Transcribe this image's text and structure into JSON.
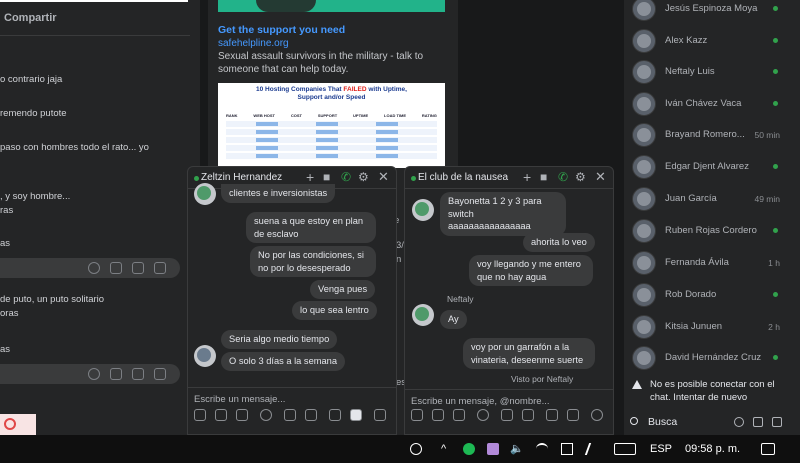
{
  "left_feed": {
    "share_label": "Compartir",
    "comments": [
      "o contrario jaja",
      "remendo putote",
      "paso con hombres todo el rato... yo",
      ", y soy hombre...",
      "ras",
      "as",
      " de puto, un puto solitario",
      "oras",
      "as"
    ]
  },
  "post": {
    "title": "Get the support you need",
    "url": "safehelpline.org",
    "description": "Sexual assault survivors in the military - talk to someone that can help today.",
    "image": {
      "title_prefix": "10 Hosting Companies That ",
      "title_highlight": "FAILED",
      "title_suffix": " with Uptime,",
      "title_line2": "Support and/or Speed",
      "columns": [
        "RANK",
        "WEB HOST",
        "COST",
        "SUPPORT",
        "UPTIME",
        "LOAD TIME",
        "RATING"
      ],
      "ranks": [
        "#1",
        "#2",
        "#3",
        "#4",
        "#5"
      ]
    },
    "fragments": [
      "e",
      "3/",
      "n",
      "es"
    ]
  },
  "contacts": [
    {
      "name": "Jesús Espinoza Moya",
      "online": true,
      "time": ""
    },
    {
      "name": "Alex Kazz",
      "online": true,
      "time": ""
    },
    {
      "name": "Neftaly Luis",
      "online": true,
      "time": ""
    },
    {
      "name": "Iván Chávez Vaca",
      "online": true,
      "time": ""
    },
    {
      "name": "Brayand Romero...",
      "online": false,
      "time": "50 min"
    },
    {
      "name": "Edgar Djent Alvarez",
      "online": true,
      "time": ""
    },
    {
      "name": "Juan García",
      "online": false,
      "time": "49 min"
    },
    {
      "name": "Ruben Rojas Cordero",
      "online": true,
      "time": ""
    },
    {
      "name": "Fernanda Ávila",
      "online": false,
      "time": "1 h"
    },
    {
      "name": "Rob Dorado",
      "online": true,
      "time": ""
    },
    {
      "name": "Kitsia Junuen",
      "online": false,
      "time": "2 h"
    },
    {
      "name": "David Hernández Cruz",
      "online": true,
      "time": ""
    }
  ],
  "connection_warning": "No es posible conectar con el chat. Intentar de nuevo",
  "search_label": "Busca",
  "chat1": {
    "title": "Zeltzin Hernandez",
    "messages": [
      "clientes e inversionistas",
      "suena a que estoy en plan de esclavo",
      "No por las condiciones, si no por lo desesperado",
      "Venga pues",
      "lo que sea lentro",
      "Seria algo medio tiempo",
      "O solo 3 días a la semana"
    ],
    "placeholder": "Escribe un mensaje..."
  },
  "chat2": {
    "title": "El club de la nausea",
    "messages": [
      "Bayonetta 1 2 y 3 para switch aaaaaaaaaaaaaaaa",
      "ahorita lo veo",
      "voy llegando y me entero que no hay agua",
      "Ay",
      "voy por un garrafón a la vinateria, deseenme suerte"
    ],
    "sender_label": "Neftaly",
    "seen_label": "Visto por Neftaly",
    "placeholder": "Escribe un mensaje, @nombre..."
  },
  "taskbar": {
    "language": "ESP",
    "time": "09:58 p. m."
  },
  "colors": {
    "accent_blue": "#4599ff",
    "online_green": "#31a24c",
    "panel_bg": "#242526",
    "bubble_bg": "#3a3b3c"
  }
}
